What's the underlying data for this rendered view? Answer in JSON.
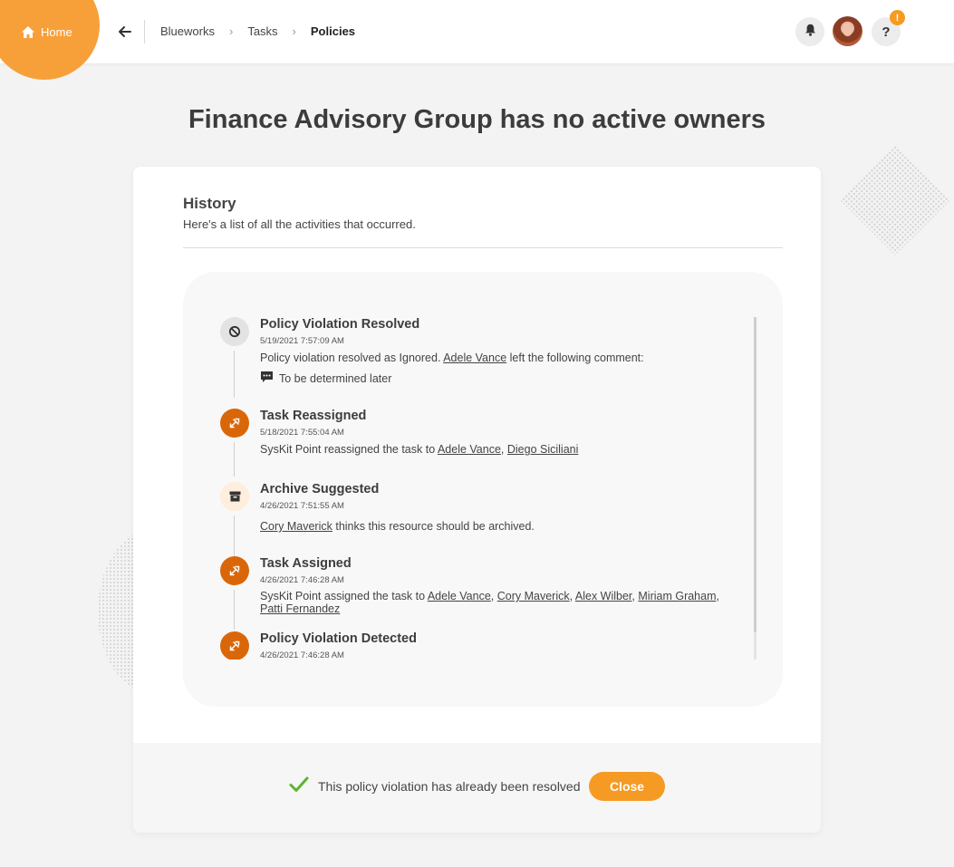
{
  "header": {
    "home_label": "Home",
    "breadcrumbs": [
      "Blueworks",
      "Tasks",
      "Policies"
    ],
    "help_badge": "!",
    "help_label": "?"
  },
  "page_title": "Finance Advisory Group has no active owners",
  "history": {
    "title": "History",
    "subtitle": "Here's a list of all the activities that occurred.",
    "events": [
      {
        "title": "Policy Violation Resolved",
        "date": "5/19/2021 7:57:09 AM",
        "icon": "ban-icon",
        "desc_before": "Policy violation resolved as Ignored. ",
        "desc_link": "Adele Vance",
        "desc_after": " left the following comment:",
        "comment": "To be determined later"
      },
      {
        "title": "Task Reassigned",
        "date": "5/18/2021 7:55:04 AM",
        "icon": "reassign-icon",
        "desc_before": "SysKit Point reassigned the task to ",
        "links": [
          "Adele Vance",
          "Diego Siciliani"
        ]
      },
      {
        "title": "Archive Suggested",
        "date": "4/26/2021 7:51:55 AM",
        "icon": "archive-icon",
        "desc_link": "Cory Maverick",
        "desc_after": " thinks this resource should be archived."
      },
      {
        "title": "Task Assigned",
        "date": "4/26/2021 7:46:28 AM",
        "icon": "assign-icon",
        "desc_before": "SysKit Point assigned the task to ",
        "links": [
          "Adele Vance",
          "Cory Maverick",
          "Alex Wilber",
          "Miriam Graham",
          "Patti Fernandez"
        ]
      },
      {
        "title": "Policy Violation Detected",
        "date": "4/26/2021 7:46:28 AM",
        "icon": "detect-icon"
      }
    ]
  },
  "footer": {
    "status_text": "This policy violation has already been resolved",
    "close_label": "Close"
  },
  "colors": {
    "accent": "#f59a23",
    "event_orange": "#d9670a",
    "check_green": "#5cb531"
  }
}
